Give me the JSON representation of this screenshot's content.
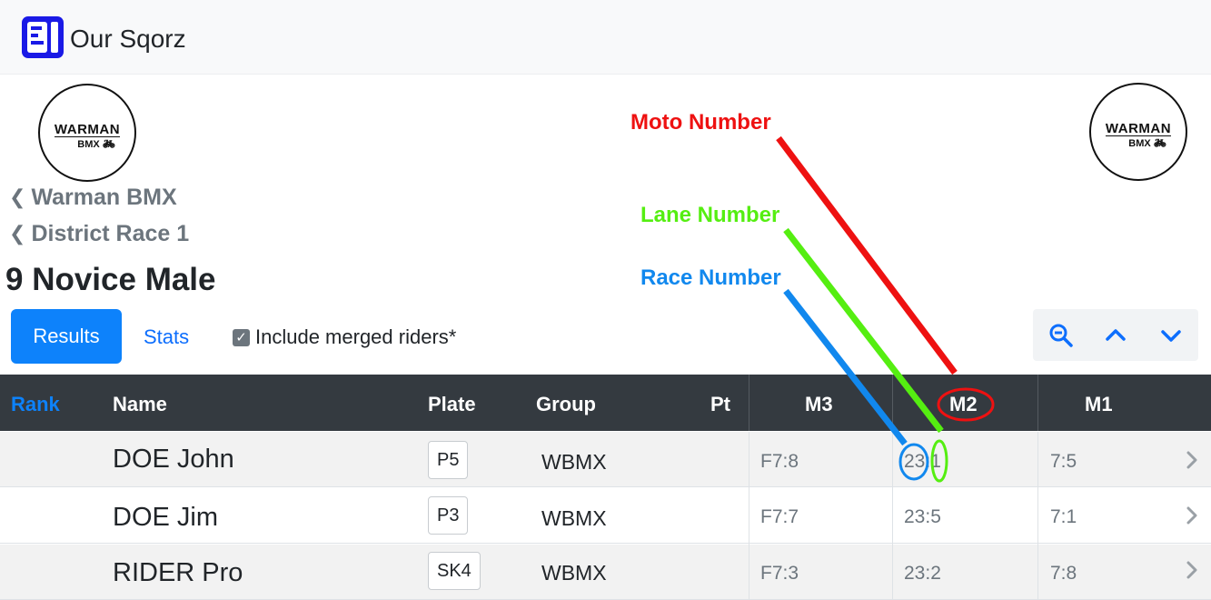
{
  "app": {
    "title": "Our Sqorz",
    "icon": "sqorz-logo-icon"
  },
  "club_logo": {
    "line1": "WARMAN",
    "line2": "BMX"
  },
  "breadcrumbs": [
    "Warman BMX",
    "District Race 1"
  ],
  "page_title": "9 Novice Male",
  "tabs": {
    "results": "Results",
    "stats": "Stats"
  },
  "merge_checkbox": {
    "label": "Include merged riders*",
    "checked": true
  },
  "toolbar": {
    "icons": [
      "zoom-out-icon",
      "chevron-up-icon",
      "chevron-down-icon"
    ]
  },
  "table": {
    "headers": {
      "rank": "Rank",
      "name": "Name",
      "plate": "Plate",
      "group": "Group",
      "pt": "Pt",
      "m3": "M3",
      "m2": "M2",
      "m1": "M1"
    },
    "rows": [
      {
        "name": "DOE John",
        "plate": "P5",
        "group": "WBMX",
        "m3": "F7:8",
        "m2": "23:1",
        "m1": "7:5"
      },
      {
        "name": "DOE Jim",
        "plate": "P3",
        "group": "WBMX",
        "m3": "F7:7",
        "m2": "23:5",
        "m1": "7:1"
      },
      {
        "name": "RIDER Pro",
        "plate": "SK4",
        "group": "WBMX",
        "m3": "F7:3",
        "m2": "23:2",
        "m1": "7:8"
      }
    ]
  },
  "annotations": {
    "moto": {
      "label": "Moto Number",
      "color": "#ee1111"
    },
    "lane": {
      "label": "Lane Number",
      "color": "#55ee11"
    },
    "race": {
      "label": "Race Number",
      "color": "#1188ee"
    }
  },
  "colors": {
    "accent": "#0d82fb",
    "header_bg": "#343a40"
  }
}
